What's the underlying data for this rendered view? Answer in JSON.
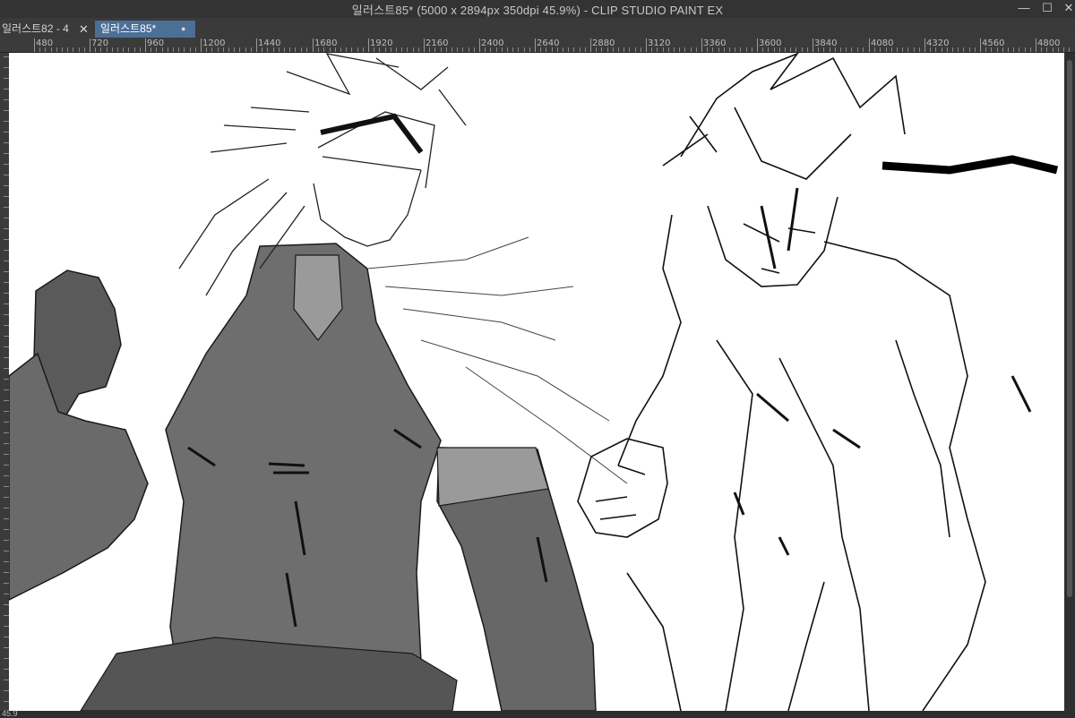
{
  "window": {
    "title": "일러스트85* (5000 x 2894px 350dpi 45.9%)  - CLIP STUDIO PAINT EX",
    "controls": {
      "minimize": "—",
      "maximize": "☐",
      "close": "✕"
    }
  },
  "tabs": [
    {
      "label": "일러스트82 - 4",
      "close": "✕",
      "active": false
    },
    {
      "label": "일러스트85*",
      "close": "●",
      "active": true
    }
  ],
  "ruler": {
    "labels": [
      "480",
      "720",
      "960",
      "1200",
      "1440",
      "1680",
      "1920",
      "2160",
      "2400",
      "2640",
      "2880",
      "3120",
      "3360",
      "3600",
      "3840",
      "4080",
      "4320",
      "4560",
      "4800"
    ]
  },
  "status": {
    "zoom": "45.9"
  },
  "colors": {
    "titlebar": "#333333",
    "active_tab": "#4c6f96",
    "canvas": "#ffffff"
  }
}
